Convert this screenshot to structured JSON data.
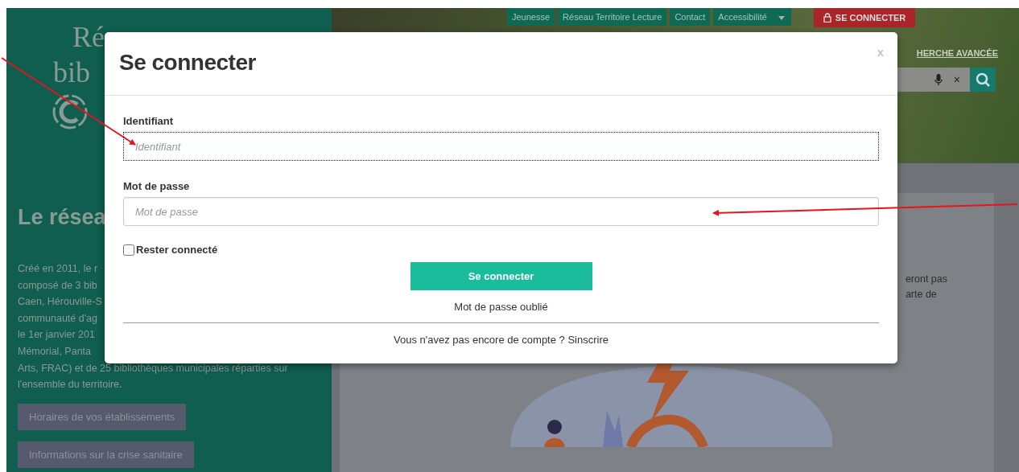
{
  "nav": {
    "items": [
      {
        "label": "Jeunesse"
      },
      {
        "label": "Réseau Territoire Lecture"
      },
      {
        "label": "Contact"
      },
      {
        "label": "Accessibilité"
      }
    ],
    "login": "SE CONNECTER"
  },
  "logo": {
    "line_1": "Ré",
    "line_2": "bib"
  },
  "advanced_search": "HERCHE AVANCÉE",
  "search": {
    "clear": "×"
  },
  "sidebar": {
    "title": "Le résea",
    "paragraph": [
      "Créé en 2011, le r",
      "composé de 3 bib",
      "Caen, Hérouville-S",
      "communauté d'ag",
      "le 1er janvier 201",
      "Mémorial, Panta",
      "Arts, FRAC) et de 25 bibliothèques municipales réparties sur",
      "l'ensemble du territoire."
    ],
    "buttons": [
      "Horaires de vos établissements",
      "Informations sur la crise sanitaire"
    ]
  },
  "content": {
    "lines": [
      "eront pas",
      "arte de"
    ]
  },
  "modal": {
    "title": "Se connecter",
    "close": "x",
    "fields": [
      {
        "label": "Identifiant",
        "placeholder": "Identifiant",
        "focused": true
      },
      {
        "label": "Mot de passe",
        "placeholder": "Mot de passe",
        "focused": false
      }
    ],
    "remember": {
      "label": "Rester connecté",
      "checked": false
    },
    "submit": "Se connecter",
    "forgot": "Mot de passe oublié",
    "signup": "Vous n'avez pas encore de compte ? Sinscrire"
  }
}
